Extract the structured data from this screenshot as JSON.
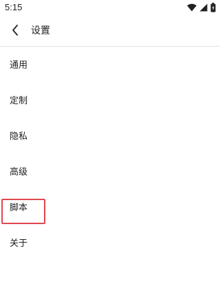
{
  "status_bar": {
    "time": "5:15",
    "icons": [
      "wifi-icon",
      "cellular-signal-icon",
      "battery-icon"
    ]
  },
  "toolbar": {
    "back_icon": "back-arrow-icon",
    "title": "设置"
  },
  "settings": {
    "items": [
      {
        "label": "通用"
      },
      {
        "label": "定制"
      },
      {
        "label": "隐私"
      },
      {
        "label": "高级"
      },
      {
        "label": "脚本",
        "highlighted": true
      },
      {
        "label": "关于"
      }
    ]
  },
  "colors": {
    "text": "#202124",
    "divider": "#e2e2e2",
    "highlight": "#e0464c",
    "background": "#ffffff"
  }
}
